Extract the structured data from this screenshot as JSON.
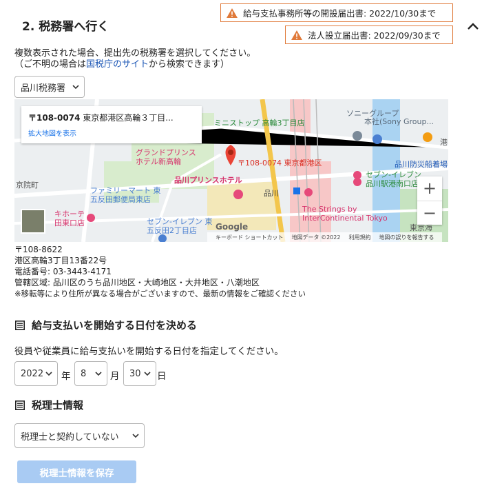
{
  "section": {
    "title": "2. 税務署へ行く"
  },
  "deadlines": [
    {
      "text": "給与支払事務所等の開設届出書: 2022/10/30まで"
    },
    {
      "text": "法人設立届出書: 2022/09/30まで"
    }
  ],
  "intro": {
    "line1": "複数表示された場合、提出先の税務署を選択してください。",
    "line2_prefix": "（ご不明の場合は",
    "line2_link": "国税庁のサイト",
    "line2_suffix": "から検索できます）"
  },
  "office_select": {
    "value": "品川税務署"
  },
  "map": {
    "card_zip": "〒108-0074",
    "card_addr": " 東京都港区高輪３丁目...",
    "card_link": "拡大地図を表示",
    "pin_label": "〒108-0074 東京都港区",
    "labels": {
      "sony_group": "ソニーグループ",
      "sony_hq": "本社(Sony Group...",
      "ministop": "ミニストップ 高輪3丁目店",
      "grand_prince": "グランドプリンス",
      "grand_prince2": "ホテル新高輪",
      "shinagawa_prince": "品川プリンスホテル",
      "familymart": "ファミリーマート 東",
      "familymart2": "五反田郵便局東店",
      "kihoten": "キホーテ",
      "kihoten2": "田東口店",
      "seven_gotanda": "セブン-イレブン 東",
      "seven_gotanda2": "五反田2丁目店",
      "shinagawa": "品川",
      "bosai": "品川防災船着場",
      "seven_konan": "セブン-イレブン",
      "seven_konan2": "品川駅港南口店",
      "strings": "The Strings by",
      "strings2": "InterContinental Tokyo",
      "kyoninmachi": "京院町",
      "minato": "港",
      "higashi": "東京海",
      "google": "Google"
    },
    "footer": {
      "keyboard": "キーボード ショートカット",
      "mapdata": "地図データ ©2022",
      "terms": "利用規約",
      "report": "地図の誤りを報告する"
    },
    "zoom_in": "+",
    "zoom_out": "−"
  },
  "office": {
    "zip": "〒108-8622",
    "address": "港区高輪3丁目13番22号",
    "phone": "電話番号: 03-3443-4171",
    "jurisdiction": "管轄区域: 品川区のうち品川地区・大崎地区・大井地区・八潮地区",
    "note": "※移転等により住所が異なる場合がございますので、最新の情報をご確認ください"
  },
  "payroll": {
    "title": "給与支払いを開始する日付を決める",
    "desc": "役員や従業員に給与支払いを開始する日付を指定してください。",
    "year": "2022",
    "year_unit": "年",
    "month": "8",
    "month_unit": "月",
    "day": "30",
    "day_unit": "日"
  },
  "accountant": {
    "title": "税理士情報",
    "select_value": "税理士と契約していない",
    "save_label": "税理士情報を保存"
  },
  "colors": {
    "warning": "#e07a3a",
    "link": "#1a55b5",
    "button_disabled": "#a9cbf3",
    "map_pin": "#ea4335"
  }
}
